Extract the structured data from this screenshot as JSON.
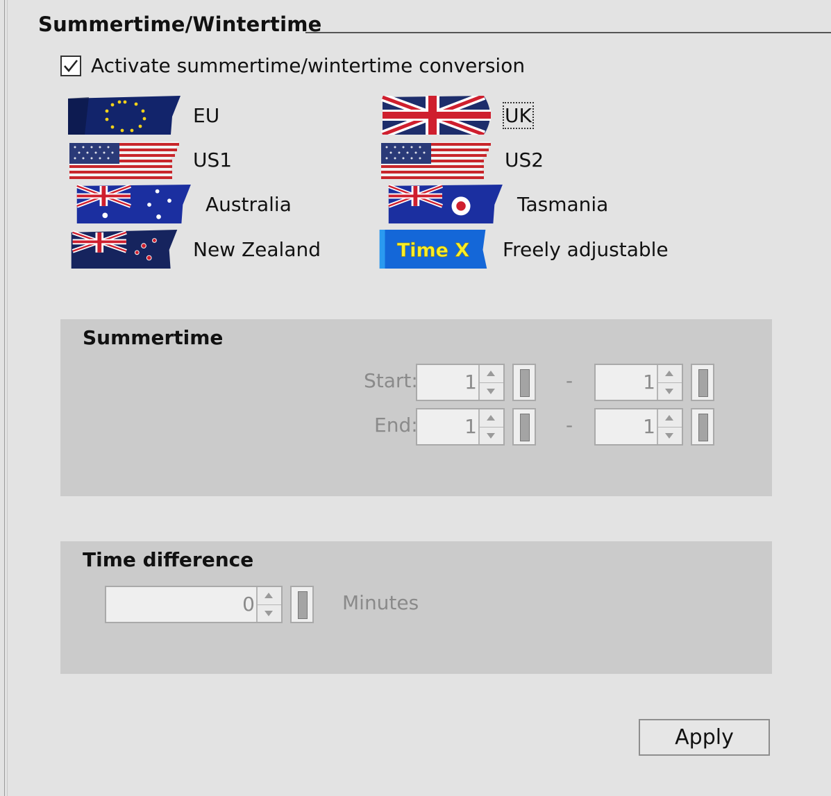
{
  "header": {
    "title": "Summertime/Wintertime"
  },
  "activate": {
    "label": "Activate summertime/wintertime conversion",
    "checked": true
  },
  "regions": [
    {
      "label": "EU",
      "icon": "eu-flag-icon"
    },
    {
      "label": "UK",
      "icon": "uk-flag-icon",
      "focused": true
    },
    {
      "label": "US1",
      "icon": "us-flag-icon"
    },
    {
      "label": "US2",
      "icon": "us-flag-icon"
    },
    {
      "label": "Australia",
      "icon": "australia-flag-icon"
    },
    {
      "label": "Tasmania",
      "icon": "tasmania-flag-icon"
    },
    {
      "label": "New Zealand",
      "icon": "new-zealand-flag-icon"
    },
    {
      "label": "Freely adjustable",
      "icon": "time-x-icon",
      "icon_text": "Time X"
    }
  ],
  "summertime": {
    "title": "Summertime",
    "start": {
      "label": "Start:",
      "value1": "1",
      "separator": "-",
      "value2": "1"
    },
    "end": {
      "label": "End:",
      "value1": "1",
      "separator": "-",
      "value2": "1"
    }
  },
  "time_difference": {
    "title": "Time difference",
    "value": "0",
    "unit": "Minutes"
  },
  "actions": {
    "apply_label": "Apply"
  },
  "colors": {
    "background": "#e3e3e3",
    "group_background": "#cbcbcb",
    "disabled_text": "#8a8a8a"
  }
}
